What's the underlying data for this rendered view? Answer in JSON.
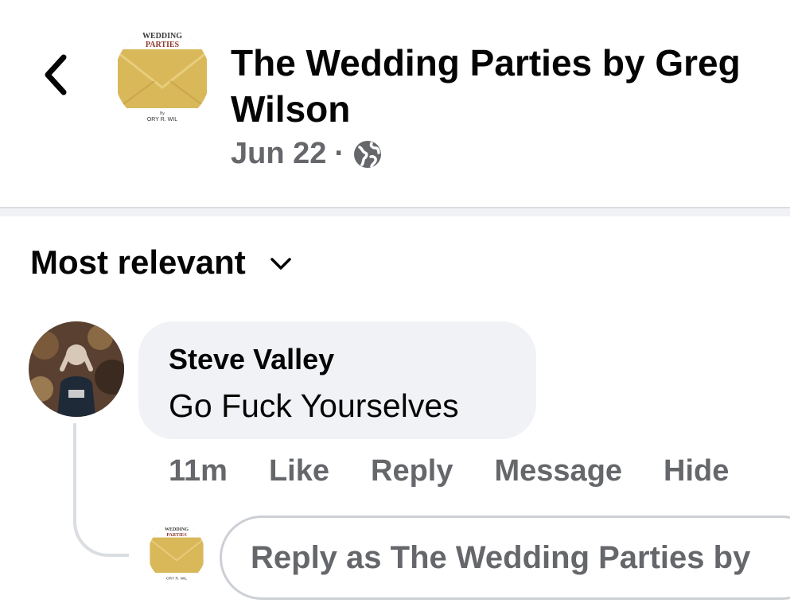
{
  "header": {
    "back_icon": "chevron-left-icon",
    "page_name": "The Wedding Parties by Greg Wilson",
    "date": "Jun 22",
    "separator": "·",
    "privacy_icon": "globe-icon",
    "avatar": {
      "logo_text_top": "Wedding Parties",
      "logo_text_bottom": "ORY R. WIL",
      "logo_text_by": "By",
      "gold_color": "#d9b85a"
    }
  },
  "sort": {
    "label": "Most relevant",
    "icon": "chevron-down-icon"
  },
  "comment": {
    "author": "Steve Valley",
    "text": "Go Fuck Yourselves",
    "time": "11m",
    "actions": [
      "Like",
      "Reply",
      "Message",
      "Hide"
    ]
  },
  "reply": {
    "placeholder": "Reply as The Wedding Parties by"
  },
  "colors": {
    "bubble_bg": "#f0f2f5",
    "secondary_text": "#65676b",
    "primary_text": "#050505"
  }
}
